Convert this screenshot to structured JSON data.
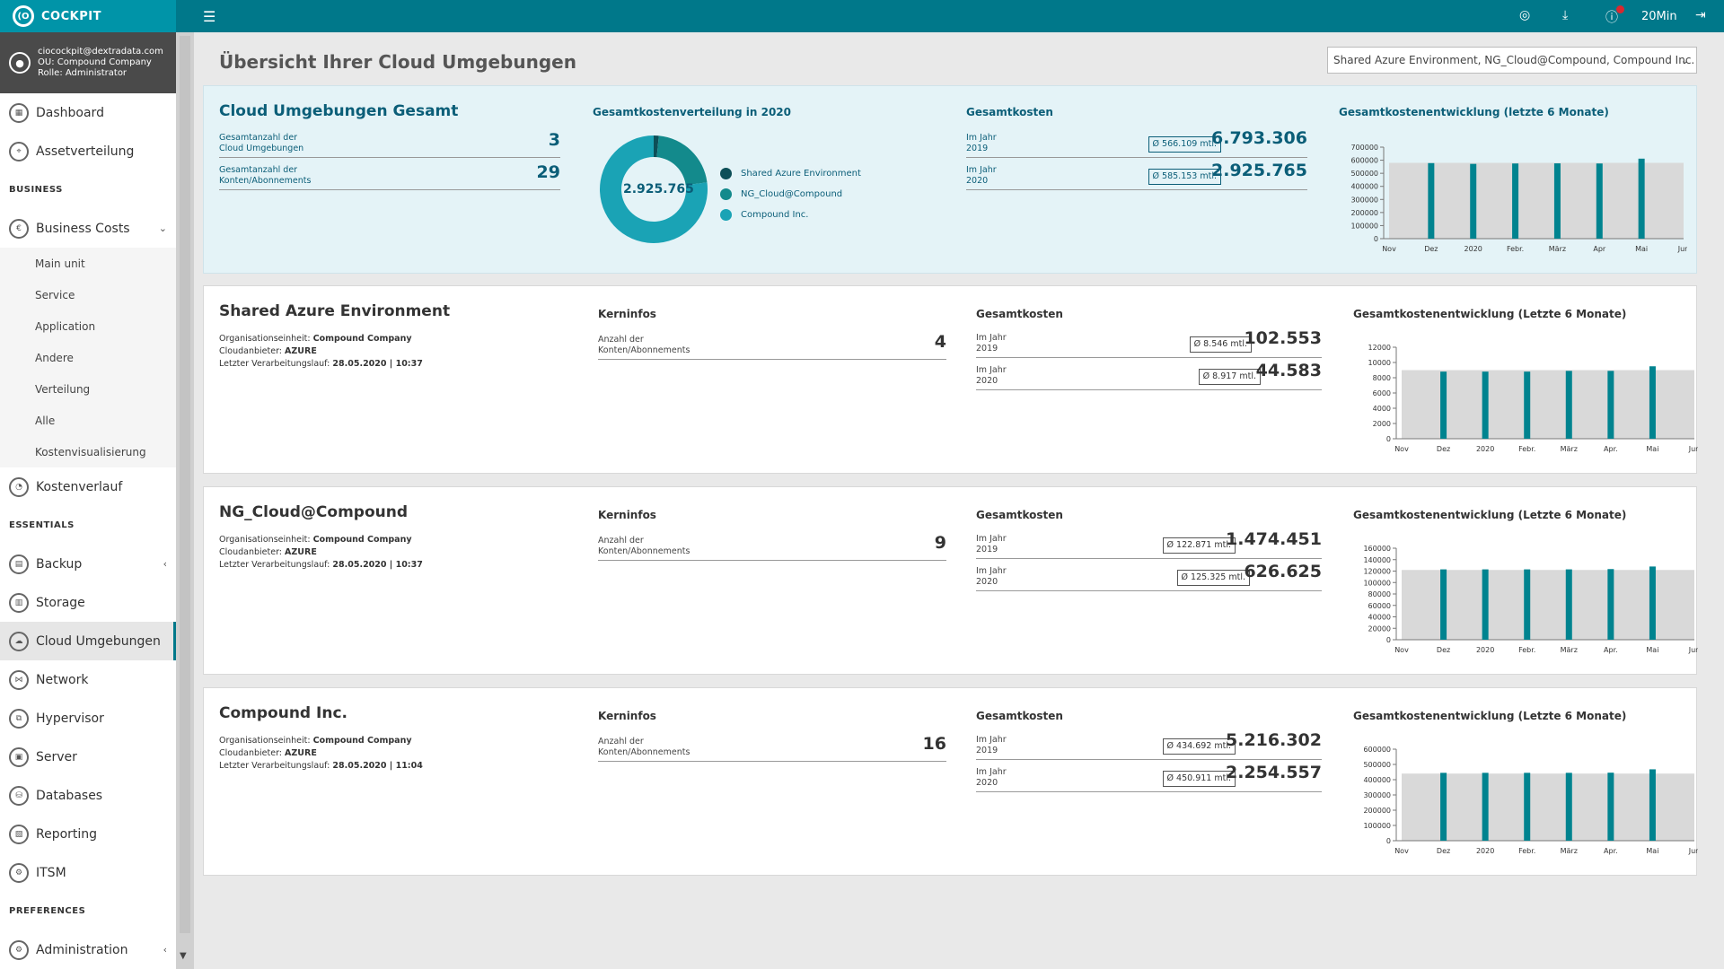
{
  "topbar": {
    "brand": "COCKPIT",
    "logo_text": "(O",
    "timer": "20Min"
  },
  "user": {
    "email": "ciocockpit@dextradata.com",
    "ou": "OU: Compound Company",
    "role": "Rolle: Administrator"
  },
  "nav": {
    "dashboard": "Dashboard",
    "assetverteilung": "Assetverteilung",
    "section_business": "BUSINESS",
    "business_costs": "Business Costs",
    "sub": [
      "Main unit",
      "Service",
      "Application",
      "Andere",
      "Verteilung",
      "Alle",
      "Kostenvisualisierung"
    ],
    "kostenverlauf": "Kostenverlauf",
    "section_essentials": "ESSENTIALS",
    "backup": "Backup",
    "storage": "Storage",
    "cloud": "Cloud Umgebungen",
    "network": "Network",
    "hypervisor": "Hypervisor",
    "server": "Server",
    "databases": "Databases",
    "reporting": "Reporting",
    "itsm": "ITSM",
    "section_preferences": "PREFERENCES",
    "administration": "Administration"
  },
  "page": {
    "title": "Übersicht Ihrer Cloud Umgebungen",
    "select_value": "Shared Azure Environment, NG_Cloud@Compound, Compound Inc."
  },
  "summary": {
    "title": "Cloud Umgebungen Gesamt",
    "row1_label_1": "Gesamtanzahl der",
    "row1_label_2": "Cloud Umgebungen",
    "row1_value": "3",
    "row2_label_1": "Gesamtanzahl der",
    "row2_label_2": "Konten/Abonnements",
    "row2_value": "29",
    "donut_title": "Gesamtkostenverteilung in 2020",
    "donut_center": "2.925.765",
    "legend": [
      "Shared Azure Environment",
      "NG_Cloud@Compound",
      "Compound Inc."
    ],
    "costs_title": "Gesamtkosten",
    "cost_label": "Im Jahr",
    "y2019": "2019",
    "y2020": "2020",
    "avg2019": "Ø 566.109 mtl.",
    "total2019": "6.793.306",
    "avg2020": "Ø 585.153 mtl.",
    "total2020": "2.925.765",
    "trend_title": "Gesamtkostenentwicklung (letzte 6 Monate)"
  },
  "envs": [
    {
      "name": "Shared Azure Environment",
      "org_label": "Organisationseinheit:",
      "org": "Compound Company",
      "provider_label": "Cloudanbieter:",
      "provider": "AZURE",
      "run_label": "Letzter Verarbeitungslauf:",
      "run": "28.05.2020 | 10:37",
      "kern_title": "Kerninfos",
      "kern_label_1": "Anzahl der",
      "kern_label_2": "Konten/Abonnements",
      "kern_value": "4",
      "costs_title": "Gesamtkosten",
      "cost_label": "Im Jahr",
      "y2019": "2019",
      "y2020": "2020",
      "avg2019": "Ø 8.546 mtl.",
      "total2019": "102.553",
      "avg2020": "Ø 8.917 mtl.",
      "total2020": "44.583",
      "trend_title": "Gesamtkostenentwicklung (Letzte 6 Monate)"
    },
    {
      "name": "NG_Cloud@Compound",
      "org_label": "Organisationseinheit:",
      "org": "Compound Company",
      "provider_label": "Cloudanbieter:",
      "provider": "AZURE",
      "run_label": "Letzter Verarbeitungslauf:",
      "run": "28.05.2020 | 10:37",
      "kern_title": "Kerninfos",
      "kern_label_1": "Anzahl der",
      "kern_label_2": "Konten/Abonnements",
      "kern_value": "9",
      "costs_title": "Gesamtkosten",
      "cost_label": "Im Jahr",
      "y2019": "2019",
      "y2020": "2020",
      "avg2019": "Ø 122.871 mtl.",
      "total2019": "1.474.451",
      "avg2020": "Ø 125.325 mtl.",
      "total2020": "626.625",
      "trend_title": "Gesamtkostenentwicklung (Letzte 6 Monate)"
    },
    {
      "name": "Compound Inc.",
      "org_label": "Organisationseinheit:",
      "org": "Compound Company",
      "provider_label": "Cloudanbieter:",
      "provider": "AZURE",
      "run_label": "Letzter Verarbeitungslauf:",
      "run": "28.05.2020 | 11:04",
      "kern_title": "Kerninfos",
      "kern_label_1": "Anzahl der",
      "kern_label_2": "Konten/Abonnements",
      "kern_value": "16",
      "costs_title": "Gesamtkosten",
      "cost_label": "Im Jahr",
      "y2019": "2019",
      "y2020": "2020",
      "avg2019": "Ø 434.692 mtl.",
      "total2019": "5.216.302",
      "avg2020": "Ø 450.911 mtl.",
      "total2020": "2.254.557",
      "trend_title": "Gesamtkostenentwicklung (Letzte 6 Monate)"
    }
  ],
  "colors": {
    "teal": "#00788a",
    "bar": "#00838f",
    "donut": [
      "#0d4f58",
      "#138a8c",
      "#1aa3b5"
    ]
  },
  "chart_data": [
    {
      "type": "pie",
      "title": "Gesamtkostenverteilung in 2020",
      "categories": [
        "Shared Azure Environment",
        "NG_Cloud@Compound",
        "Compound Inc."
      ],
      "values": [
        44583,
        626625,
        2254557
      ],
      "center_label": "2.925.765"
    },
    {
      "type": "bar",
      "title": "Gesamtkostenentwicklung (letzte 6 Monate)",
      "categories": [
        "Dez",
        "2020",
        "Febr.",
        "März",
        "Apr",
        "Mai"
      ],
      "x_ticks": [
        "Nov",
        "Dez",
        "2020",
        "Febr.",
        "März",
        "Apr",
        "Mai",
        "Jun"
      ],
      "values": [
        578000,
        572000,
        575000,
        576000,
        575000,
        612000
      ],
      "band": 580000,
      "ylim": [
        0,
        700000
      ],
      "yticks": [
        0,
        100000,
        200000,
        300000,
        400000,
        500000,
        600000,
        700000
      ]
    },
    {
      "type": "bar",
      "title": "Gesamtkostenentwicklung (Letzte 6 Monate)",
      "categories": [
        "Dez",
        "2020",
        "Febr.",
        "März",
        "Apr.",
        "Mai"
      ],
      "x_ticks": [
        "Nov",
        "Dez",
        "2020",
        "Febr.",
        "März",
        "Apr.",
        "Mai",
        "Jun"
      ],
      "values": [
        8800,
        8800,
        8800,
        8900,
        8900,
        9500
      ],
      "band": 9000,
      "ylim": [
        0,
        12000
      ],
      "yticks": [
        0,
        2000,
        4000,
        6000,
        8000,
        10000,
        12000
      ]
    },
    {
      "type": "bar",
      "title": "Gesamtkostenentwicklung (Letzte 6 Monate)",
      "categories": [
        "Dez",
        "2020",
        "Febr.",
        "März",
        "Apr.",
        "Mai"
      ],
      "x_ticks": [
        "Nov",
        "Dez",
        "2020",
        "Febr.",
        "März",
        "Apr.",
        "Mai",
        "Jun"
      ],
      "values": [
        123000,
        123000,
        123000,
        123000,
        123500,
        128000
      ],
      "band": 122000,
      "ylim": [
        0,
        160000
      ],
      "yticks": [
        0,
        20000,
        40000,
        60000,
        80000,
        100000,
        120000,
        140000,
        160000
      ]
    },
    {
      "type": "bar",
      "title": "Gesamtkostenentwicklung (Letzte 6 Monate)",
      "categories": [
        "Dez",
        "2020",
        "Febr.",
        "März",
        "Apr.",
        "Mai"
      ],
      "x_ticks": [
        "Nov",
        "Dez",
        "2020",
        "Febr.",
        "März",
        "Apr.",
        "Mai",
        "Jun"
      ],
      "values": [
        445000,
        445000,
        445000,
        445000,
        446000,
        468000
      ],
      "band": 440000,
      "ylim": [
        0,
        600000
      ],
      "yticks": [
        0,
        100000,
        200000,
        300000,
        400000,
        500000,
        600000
      ]
    }
  ]
}
